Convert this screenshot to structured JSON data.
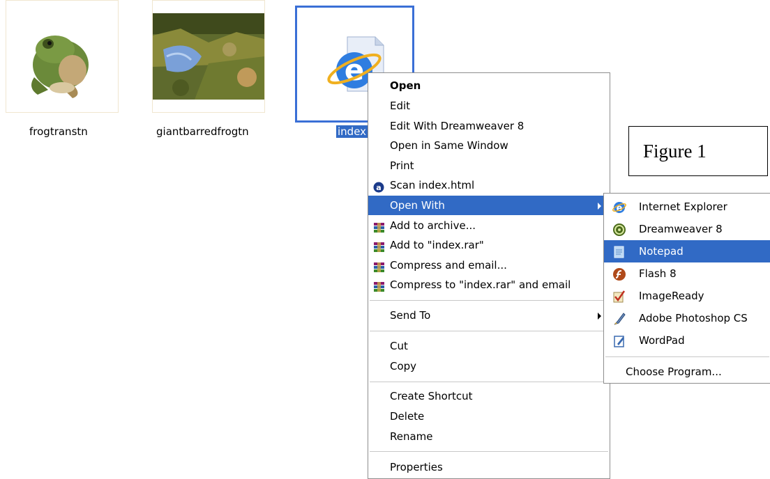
{
  "files": [
    {
      "name": "frogtranstn"
    },
    {
      "name": "giantbarredfrogtn"
    },
    {
      "name": "index"
    }
  ],
  "context_menu": {
    "items": [
      {
        "label": "Open"
      },
      {
        "label": "Edit"
      },
      {
        "label": "Edit With Dreamweaver 8"
      },
      {
        "label": "Open in Same Window"
      },
      {
        "label": "Print"
      },
      {
        "label": "Scan index.html"
      },
      {
        "label": "Open With"
      },
      {
        "label": "Add to archive..."
      },
      {
        "label": "Add to \"index.rar\""
      },
      {
        "label": "Compress and email..."
      },
      {
        "label": "Compress to \"index.rar\" and email"
      },
      {
        "label": "Send To"
      },
      {
        "label": "Cut"
      },
      {
        "label": "Copy"
      },
      {
        "label": "Create Shortcut"
      },
      {
        "label": "Delete"
      },
      {
        "label": "Rename"
      },
      {
        "label": "Properties"
      }
    ]
  },
  "open_with_submenu": {
    "items": [
      {
        "label": "Internet Explorer",
        "icon": "internet-explorer-icon"
      },
      {
        "label": "Dreamweaver 8",
        "icon": "dreamweaver-icon"
      },
      {
        "label": "Notepad",
        "icon": "notepad-icon"
      },
      {
        "label": "Flash 8",
        "icon": "flash-icon"
      },
      {
        "label": "ImageReady",
        "icon": "imageready-icon"
      },
      {
        "label": "Adobe Photoshop CS",
        "icon": "photoshop-icon"
      },
      {
        "label": "WordPad",
        "icon": "wordpad-icon"
      },
      {
        "label": "Choose Program..."
      }
    ]
  },
  "figure_label": "Figure 1",
  "colors": {
    "highlight": "#316ac5",
    "selection_border": "#3a6fd6"
  }
}
